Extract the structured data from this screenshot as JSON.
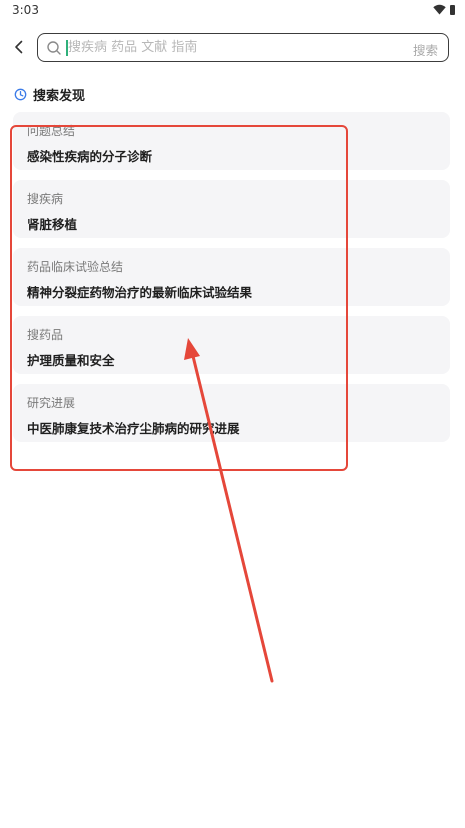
{
  "status_bar": {
    "time": "3:03",
    "icons": [
      "wifi-icon",
      "battery-icon"
    ]
  },
  "header": {
    "back_icon": "chevron-left-icon",
    "search": {
      "icon": "search-icon",
      "placeholder": "搜疾病 药品 文献 指南",
      "value": "",
      "submit_label": "搜索"
    }
  },
  "discover": {
    "icon": "clock-icon",
    "title": "搜索发现",
    "items": [
      {
        "category": "问题总结",
        "title": "感染性疾病的分子诊断"
      },
      {
        "category": "搜疾病",
        "title": "肾脏移植"
      },
      {
        "category": "药品临床试验总结",
        "title": "精神分裂症药物治疗的最新临床试验结果"
      },
      {
        "category": "搜药品",
        "title": "护理质量和安全"
      },
      {
        "category": "研究进展",
        "title": "中医肺康复技术治疗尘肺病的研究进展"
      }
    ]
  },
  "colors": {
    "accent_cursor": "#2fb07a",
    "annotation": "#e5473a",
    "card_bg": "#f5f5f7",
    "clock_icon": "#3b7be8"
  }
}
